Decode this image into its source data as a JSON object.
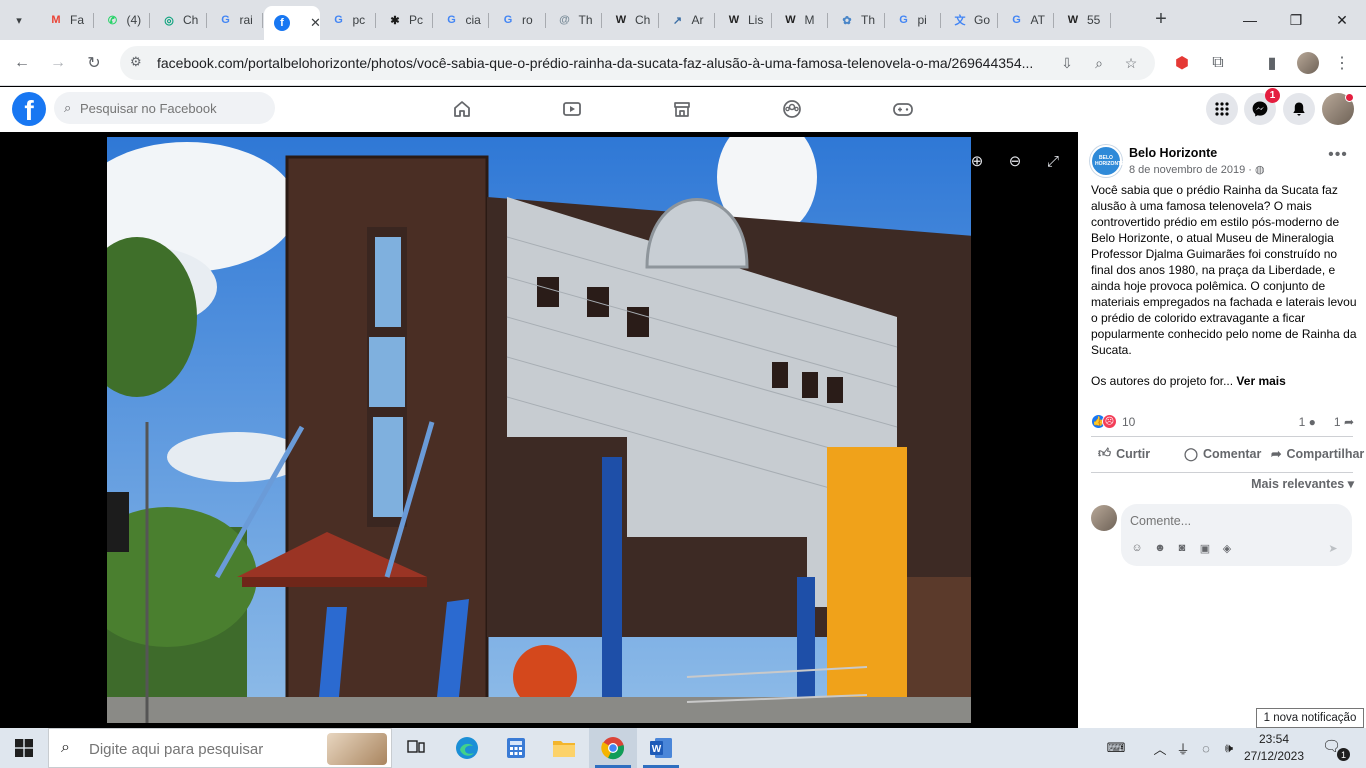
{
  "browser": {
    "tabs": [
      {
        "label": "Fa",
        "favicon": "gmail-icon",
        "color": "#ea4335",
        "glyph": "M"
      },
      {
        "label": "(4)",
        "favicon": "whatsapp-icon",
        "color": "#25d366",
        "glyph": "✆"
      },
      {
        "label": "Ch",
        "favicon": "chatgpt-icon",
        "color": "#10a37f",
        "glyph": "◎"
      },
      {
        "label": "rai",
        "favicon": "google-icon",
        "color": "#4285f4",
        "glyph": "G"
      },
      {
        "label": "",
        "favicon": "facebook-icon",
        "color": "#1877f2",
        "glyph": "f",
        "active": true
      },
      {
        "label": "pc",
        "favicon": "google-icon",
        "color": "#4285f4",
        "glyph": "G"
      },
      {
        "label": "Pc",
        "favicon": "perplexity-icon",
        "color": "#1b1b1b",
        "glyph": "✱"
      },
      {
        "label": "cia",
        "favicon": "google-icon",
        "color": "#4285f4",
        "glyph": "G"
      },
      {
        "label": "ro",
        "favicon": "google-icon",
        "color": "#4285f4",
        "glyph": "G"
      },
      {
        "label": "Th",
        "favicon": "cosmos-icon",
        "color": "#7a8c99",
        "glyph": "@"
      },
      {
        "label": "Ch",
        "favicon": "wikipedia-icon",
        "color": "#222",
        "glyph": "W"
      },
      {
        "label": "Ar",
        "favicon": "tool-icon",
        "color": "#3b6ea5",
        "glyph": "↗"
      },
      {
        "label": "Lis",
        "favicon": "wikipedia-icon",
        "color": "#222",
        "glyph": "W"
      },
      {
        "label": "M",
        "favicon": "wikipedia-icon",
        "color": "#222",
        "glyph": "W"
      },
      {
        "label": "Th",
        "favicon": "globe-icon",
        "color": "#4a86c8",
        "glyph": "✿"
      },
      {
        "label": "pi",
        "favicon": "google-icon",
        "color": "#4285f4",
        "glyph": "G"
      },
      {
        "label": "Go",
        "favicon": "translate-icon",
        "color": "#4285f4",
        "glyph": "文"
      },
      {
        "label": "AT",
        "favicon": "google-icon",
        "color": "#4285f4",
        "glyph": "G"
      },
      {
        "label": "55",
        "favicon": "wikipedia-icon",
        "color": "#222",
        "glyph": "W"
      }
    ],
    "url": "facebook.com/portalbelohorizonte/photos/você-sabia-que-o-prédio-rainha-da-sucata-faz-alusão-à-uma-famosa-telenovela-o-ma/269644354..."
  },
  "facebook": {
    "search_placeholder": "Pesquisar no Facebook",
    "messenger_badge": "1",
    "post": {
      "page_name": "Belo Horizonte",
      "page_avatar_text": "BELO HORIZONTE",
      "date": "8 de novembro de 2019 ·",
      "text": "Você sabia que o prédio Rainha da Sucata faz alusão à uma famosa telenovela? O mais controvertido prédio em estilo pós-moderno de Belo Horizonte, o atual Museu de Mineralogia Professor Djalma Guimarães foi construído no final dos anos 1980, na praça da Liberdade, e ainda hoje provoca polêmica. O conjunto de materiais empregados na fachada e laterais levou o prédio de colorido extravagante a ficar popularmente conhecido pelo nome de Rainha da Sucata.",
      "text_more": "Os autores do projeto for...",
      "see_more": "Ver mais",
      "reaction_count": "10",
      "comment_count": "1",
      "share_count": "1",
      "like_label": "Curtir",
      "comment_label": "Comentar",
      "share_label": "Compartilhar",
      "sort_label": "Mais relevantes",
      "comment_placeholder": "Comente..."
    },
    "notification_toast": "1 nova notificação"
  },
  "taskbar": {
    "search_placeholder": "Digite aqui para pesquisar",
    "time": "23:54",
    "date": "27/12/2023",
    "notification_count": "1"
  }
}
